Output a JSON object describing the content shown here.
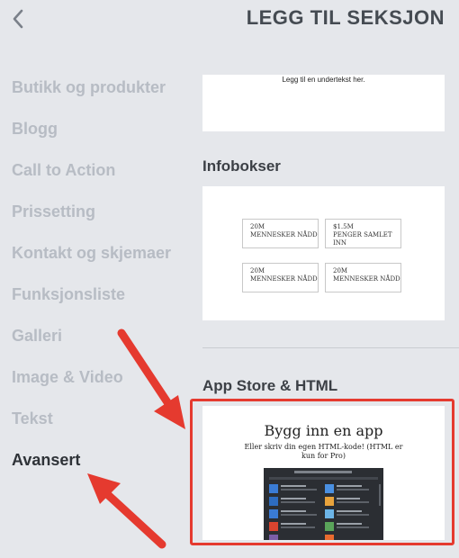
{
  "header": {
    "title": "LEGG TIL SEKSJON"
  },
  "sidebar": {
    "items": [
      {
        "label": "Butikk og produkter"
      },
      {
        "label": "Blogg"
      },
      {
        "label": "Call to Action"
      },
      {
        "label": "Prissetting"
      },
      {
        "label": "Kontakt og skjemaer"
      },
      {
        "label": "Funksjonsliste"
      },
      {
        "label": "Galleri"
      },
      {
        "label": "Image & Video"
      },
      {
        "label": "Tekst"
      },
      {
        "label": "Avansert"
      }
    ],
    "active": "Avansert"
  },
  "sections": {
    "text_preview": {
      "subtitle": "Legg til en undertekst her."
    },
    "infobokser": {
      "heading": "Infobokser",
      "boxes": [
        {
          "value": "20M",
          "label": "MENNESKER NÅDD"
        },
        {
          "value": "$1.5M",
          "label": "PENGER SAMLET INN"
        },
        {
          "value": "20M",
          "label": "MENNESKER NÅDD"
        },
        {
          "value": "20M",
          "label": "MENNESKER NÅDD"
        }
      ]
    },
    "app_store": {
      "heading": "App Store & HTML",
      "title": "Bygg inn en app",
      "subtitle": "Eller skriv din egen HTML-kode! (HTML er kun for Pro)"
    }
  },
  "colors": {
    "highlight": "#e53a2f",
    "active_nav": "#2f3338",
    "inactive_nav": "#b7bcc4"
  }
}
